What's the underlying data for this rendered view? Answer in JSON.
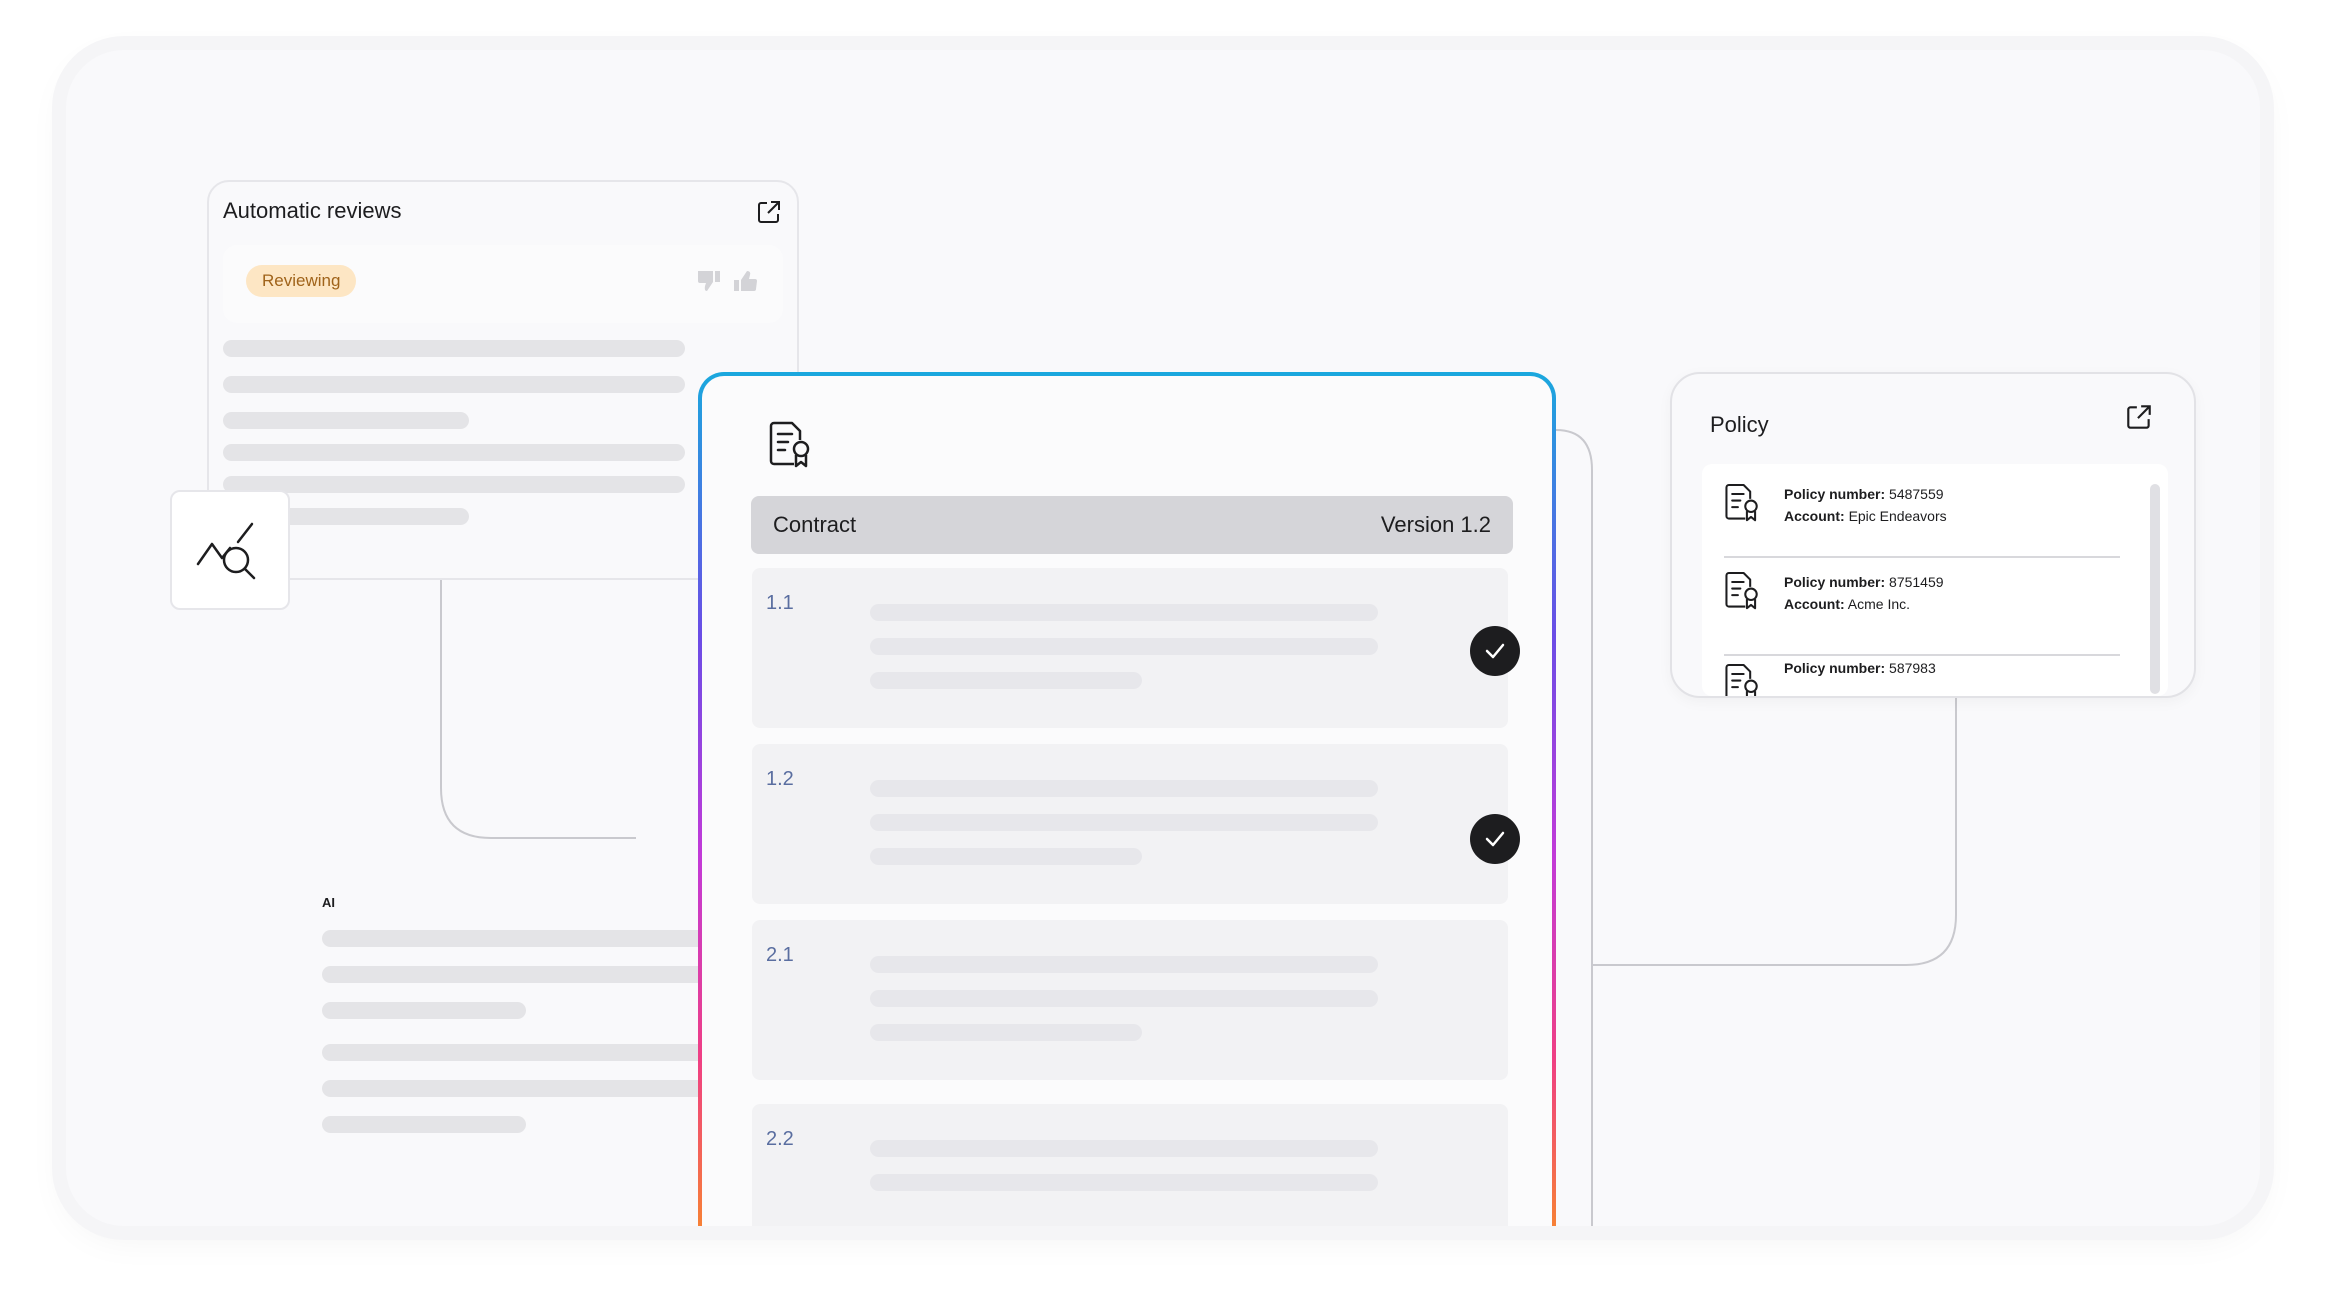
{
  "reviews_card": {
    "title": "Automatic reviews",
    "status_badge": "Reviewing",
    "open_icon": "external-link-icon",
    "feedback_icons": [
      "thumbs-down-icon",
      "thumbs-up-icon"
    ]
  },
  "analytics_tile": {
    "icon": "chart-search-icon"
  },
  "ai_section": {
    "label": "AI"
  },
  "contract": {
    "icon": "certificate-document-icon",
    "title": "Contract",
    "version": "Version 1.2",
    "clauses": [
      {
        "number": "1.1",
        "checked": true
      },
      {
        "number": "1.2",
        "checked": true
      },
      {
        "number": "2.1",
        "checked": false
      },
      {
        "number": "2.2",
        "checked": false
      }
    ]
  },
  "policy_card": {
    "title": "Policy",
    "open_icon": "external-link-icon",
    "items": [
      {
        "number_label": "Policy number:",
        "number": "5487559",
        "account_label": "Account:",
        "account": "Epic Endeavors"
      },
      {
        "number_label": "Policy number:",
        "number": "8751459",
        "account_label": "Account:",
        "account": "Acme Inc."
      },
      {
        "number_label": "Policy number:",
        "number": "587983"
      }
    ]
  },
  "colors": {
    "badge_bg": "#fde6c4",
    "badge_text": "#a0631a",
    "gradient": [
      "#1aa8de",
      "#6b4de6",
      "#c23ad8",
      "#ef3f84",
      "#f88a2a"
    ],
    "check_bg": "#1d1d1f"
  }
}
